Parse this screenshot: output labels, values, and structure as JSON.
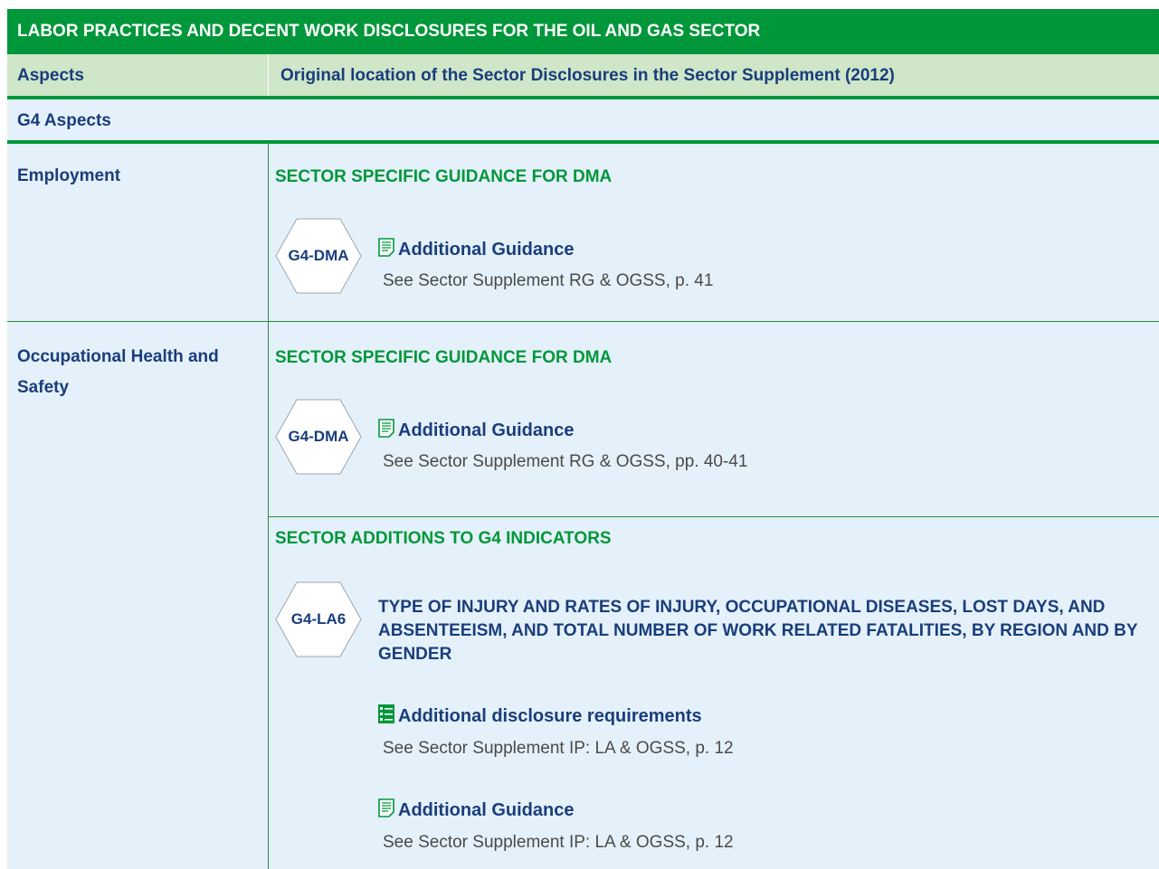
{
  "title": "LABOR PRACTICES AND DECENT WORK DISCLOSURES FOR THE OIL AND GAS SECTOR",
  "header": {
    "col1": "Aspects",
    "col2": "Original location of the Sector Disclosures in the Sector Supplement (2012)"
  },
  "g4_aspects_label": "G4 Aspects",
  "colors": {
    "green": "#00973a",
    "navy": "#1a3d7c",
    "header_bg": "#cfe6c8",
    "body_bg": "#e5f1fa"
  },
  "rows": [
    {
      "aspect": "Employment",
      "section": "SECTOR SPECIFIC GUIDANCE FOR DMA",
      "hex_label": "G4-DMA",
      "item_title": "Additional Guidance",
      "item_icon": "document-icon",
      "item_text": "See Sector Supplement RG & OGSS, p. 41"
    },
    {
      "aspect": "Occupational Health and Safety",
      "section": "SECTOR SPECIFIC GUIDANCE FOR DMA",
      "hex_label": "G4-DMA",
      "item_title": "Additional Guidance",
      "item_icon": "document-icon",
      "item_text": "See Sector Supplement RG & OGSS, pp. 40-41"
    }
  ],
  "additions": {
    "section": "SECTOR ADDITIONS TO G4 INDICATORS",
    "hex_label": "G4-LA6",
    "indicator_title": "TYPE OF INJURY AND RATES OF INJURY, OCCUPATIONAL DISEASES, LOST DAYS, AND ABSENTEEISM, AND TOTAL NUMBER OF WORK RELATED FATALITIES, BY REGION AND BY GENDER",
    "items": [
      {
        "icon": "list-icon",
        "title": "Additional disclosure requirements",
        "text": "See Sector Supplement IP: LA & OGSS, p. 12"
      },
      {
        "icon": "document-icon",
        "title": "Additional Guidance",
        "text": "See Sector Supplement IP: LA & OGSS, p. 12"
      }
    ]
  }
}
